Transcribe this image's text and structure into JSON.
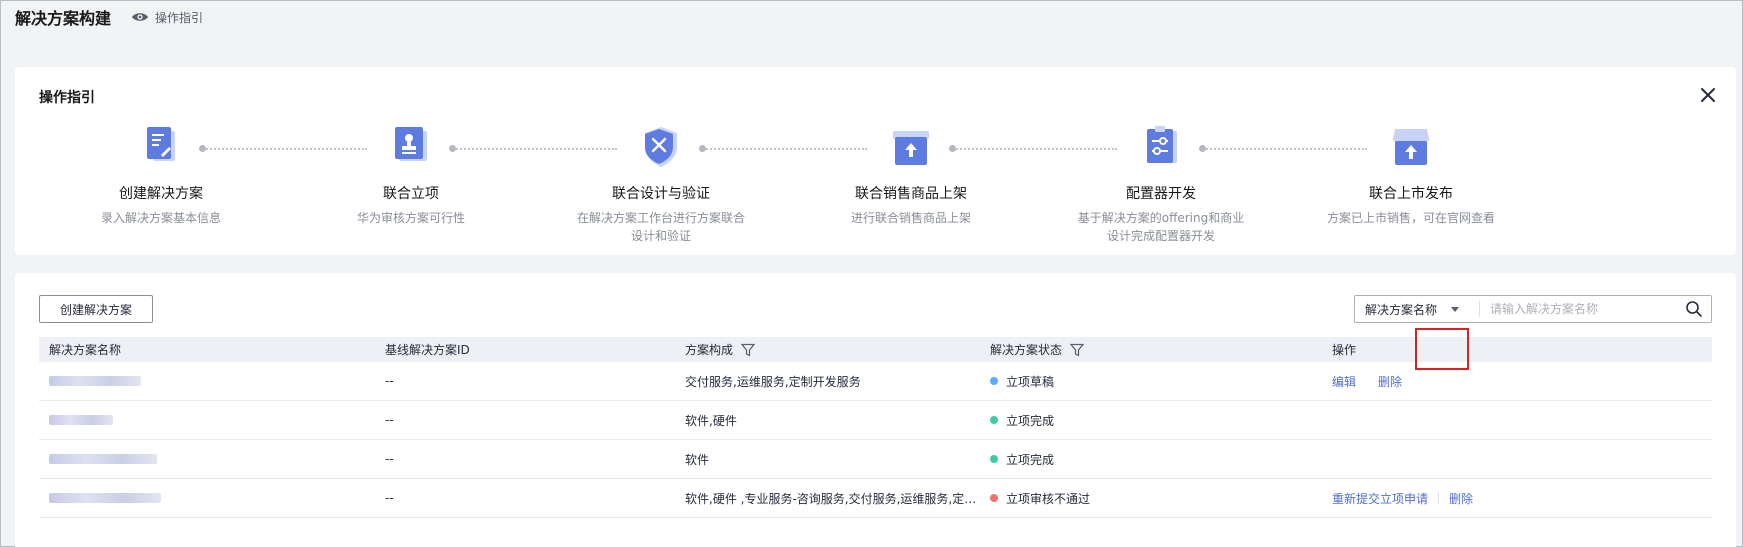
{
  "header": {
    "title": "解决方案构建",
    "guide_link": "操作指引",
    "guide_icon": "eye-icon"
  },
  "guide": {
    "title": "操作指引",
    "close_icon": "close-icon",
    "steps": [
      {
        "title": "创建解决方案",
        "desc_line1": "录入解决方案基本信息",
        "desc_line2": "",
        "icon": "document-edit-icon"
      },
      {
        "title": "联合立项",
        "desc_line1": "华为审核方案可行性",
        "desc_line2": "",
        "icon": "stamp-icon"
      },
      {
        "title": "联合设计与验证",
        "desc_line1": "在解决方案工作台进行方案联合",
        "desc_line2": "设计和验证",
        "icon": "shield-tools-icon"
      },
      {
        "title": "联合销售商品上架",
        "desc_line1": "进行联合销售商品上架",
        "desc_line2": "",
        "icon": "box-upload-icon"
      },
      {
        "title": "配置器开发",
        "desc_line1": "基于解决方案的offering和商业",
        "desc_line2": "设计完成配置器开发",
        "icon": "clipboard-settings-icon"
      },
      {
        "title": "联合上市发布",
        "desc_line1": "方案已上市销售，可在官网查看",
        "desc_line2": "",
        "icon": "store-upload-icon"
      }
    ]
  },
  "toolbar": {
    "create_label": "创建解决方案",
    "search_field": "解决方案名称",
    "search_placeholder": "请输入解决方案名称"
  },
  "table": {
    "columns": [
      "解决方案名称",
      "基线解决方案ID",
      "方案构成",
      "解决方案状态",
      "操作"
    ],
    "rows": [
      {
        "id": "--",
        "composition": "交付服务,运维服务,定制开发服务",
        "status": "立项草稿",
        "status_color": "#5cacff",
        "actions": [
          "编辑",
          "删除"
        ]
      },
      {
        "id": "--",
        "composition": "软件,硬件",
        "status": "立项完成",
        "status_color": "#3dcca6",
        "actions": []
      },
      {
        "id": "--",
        "composition": "软件",
        "status": "立项完成",
        "status_color": "#3dcca6",
        "actions": []
      },
      {
        "id": "--",
        "composition": "软件,硬件 ,专业服务-咨询服务,交付服务,运维服务,定制开...",
        "status": "立项审核不通过",
        "status_color": "#f66f6a",
        "actions": [
          "重新提交立项申请",
          "删除"
        ]
      }
    ]
  },
  "colors": {
    "link": "#526ecc",
    "highlight": "#e02020",
    "icon_blue": "#5e7ce0"
  }
}
